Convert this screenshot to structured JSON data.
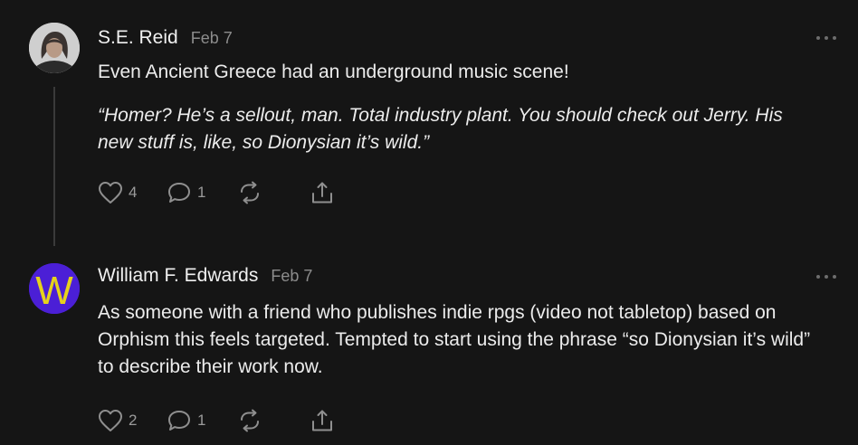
{
  "comments": [
    {
      "author": "S.E. Reid",
      "date": "Feb 7",
      "text": "Even Ancient Greece had an underground music scene!",
      "quote": "“Homer? He’s a sellout, man. Total industry plant. You should check out Jerry. His new stuff is, like, so Dionysian it’s wild.”",
      "likes": "4",
      "replies": "1",
      "avatar_icon": "profile-photo"
    },
    {
      "author": "William F. Edwards",
      "date": "Feb 7",
      "text": "As someone with a friend who publishes indie rpgs (video not tabletop) based on Orphism this feels targeted. Tempted to start using the phrase “so Dionysian it’s wild” to describe their work now.",
      "likes": "2",
      "replies": "1",
      "avatar_letter": "W"
    }
  ],
  "colors": {
    "background": "#151515",
    "text": "#ececec",
    "muted": "#8c8c8c",
    "avatar_purple": "#4b1fd6",
    "avatar_yellow": "#e6d21c"
  },
  "icons": [
    "heart-icon",
    "comment-icon",
    "restack-icon",
    "share-icon",
    "more-icon"
  ]
}
